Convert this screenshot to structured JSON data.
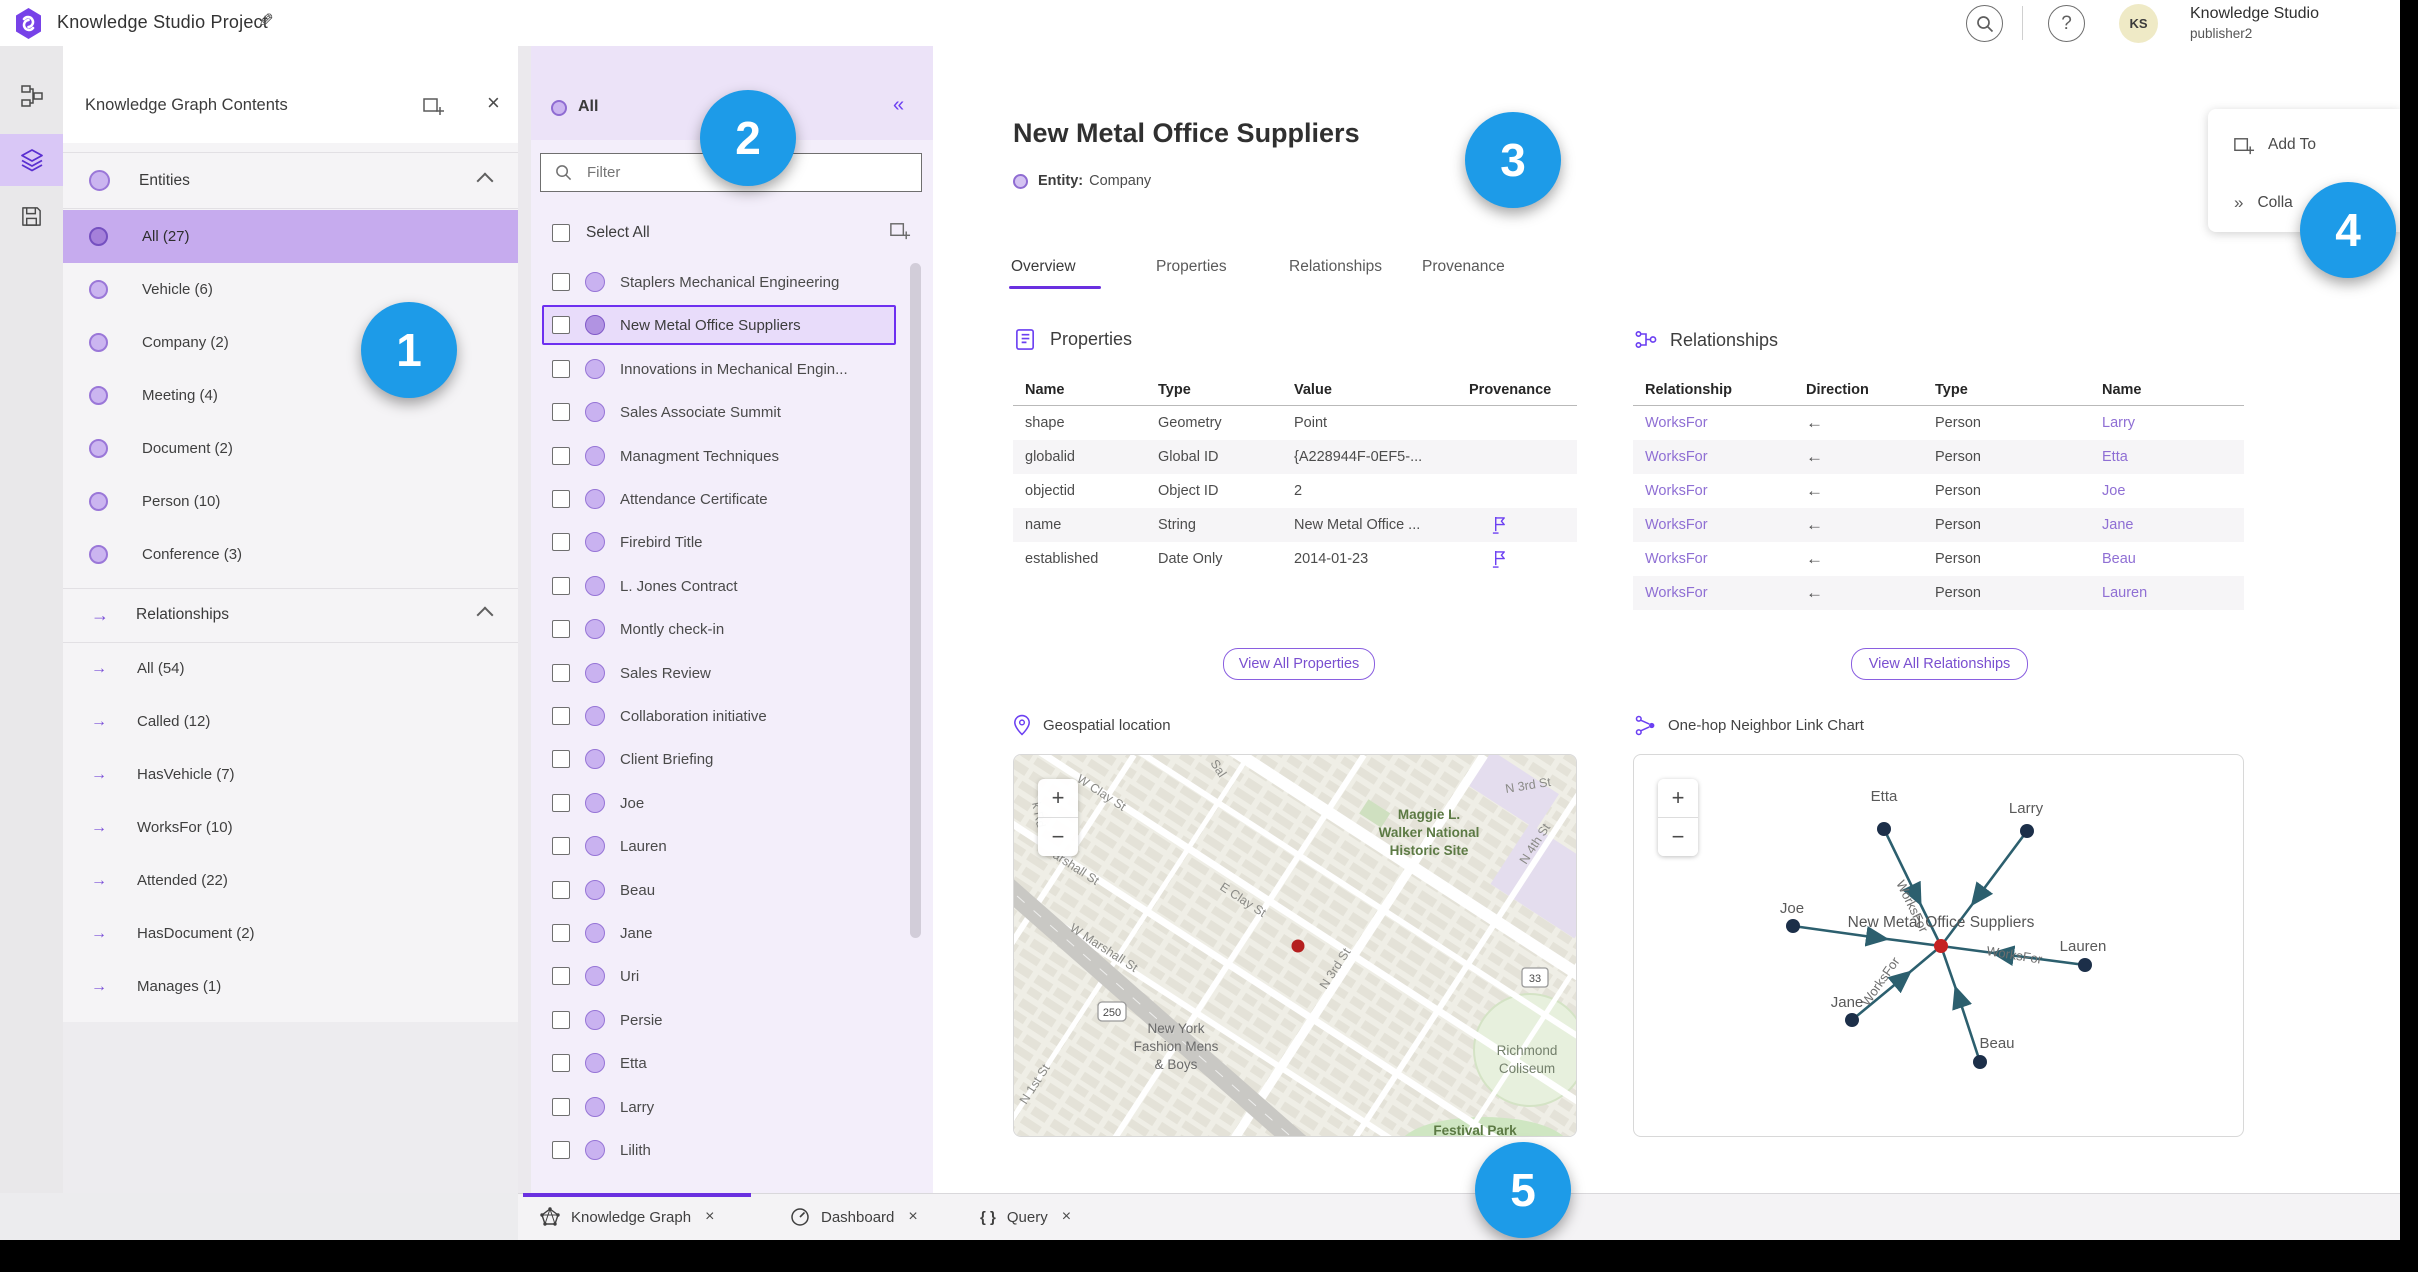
{
  "topbar": {
    "title": "Knowledge Studio Project",
    "user_initials": "KS",
    "user_name": "Knowledge Studio",
    "user_role": "publisher2"
  },
  "icons": {
    "close": "×",
    "collapse_left": "«",
    "expand_right": "»",
    "edit_pencil": "✎",
    "help": "?",
    "arrow_right": "→",
    "plus": "+",
    "minus": "−",
    "braces": "{ }"
  },
  "contents_panel": {
    "title": "Knowledge Graph Contents",
    "entities": {
      "label": "Entities",
      "items": [
        "All (27)",
        "Vehicle (6)",
        "Company (2)",
        "Meeting (4)",
        "Document (2)",
        "Person (10)",
        "Conference (3)"
      ]
    },
    "relationships": {
      "label": "Relationships",
      "items": [
        "All (54)",
        "Called (12)",
        "HasVehicle (7)",
        "WorksFor (10)",
        "Attended (22)",
        "HasDocument (2)",
        "Manages (1)"
      ]
    }
  },
  "list_panel": {
    "header": "All",
    "filter_placeholder": "Filter",
    "select_all": "Select All",
    "items": [
      "Staplers Mechanical Engineering",
      "New Metal Office Suppliers",
      "Innovations in Mechanical Engin...",
      "Sales Associate Summit",
      "Managment Techniques",
      "Attendance Certificate",
      "Firebird Title",
      "L. Jones Contract",
      "Montly check-in",
      "Sales Review",
      "Collaboration initiative",
      "Client Briefing",
      "Joe",
      "Lauren",
      "Beau",
      "Jane",
      "Uri",
      "Persie",
      "Etta",
      "Larry",
      "Lilith"
    ]
  },
  "detail": {
    "title": "New Metal Office Suppliers",
    "entity_label": "Entity:",
    "entity_type": "Company",
    "tabs": [
      "Overview",
      "Properties",
      "Relationships",
      "Provenance"
    ],
    "properties": {
      "heading": "Properties",
      "columns": [
        "Name",
        "Type",
        "Value",
        "Provenance"
      ],
      "rows": [
        {
          "name": "shape",
          "type": "Geometry",
          "value": "Point"
        },
        {
          "name": "globalid",
          "type": "Global ID",
          "value": "{A228944F-0EF5-..."
        },
        {
          "name": "objectid",
          "type": "Object ID",
          "value": "2"
        },
        {
          "name": "name",
          "type": "String",
          "value": "New Metal Office ..."
        },
        {
          "name": "established",
          "type": "Date Only",
          "value": "2014-01-23"
        }
      ],
      "view_all": "View All Properties"
    },
    "relationships": {
      "heading": "Relationships",
      "columns": [
        "Relationship",
        "Direction",
        "Type",
        "Name"
      ],
      "rows": [
        {
          "relationship": "WorksFor",
          "direction": "←",
          "type": "Person",
          "name": "Larry"
        },
        {
          "relationship": "WorksFor",
          "direction": "←",
          "type": "Person",
          "name": "Etta"
        },
        {
          "relationship": "WorksFor",
          "direction": "←",
          "type": "Person",
          "name": "Joe"
        },
        {
          "relationship": "WorksFor",
          "direction": "←",
          "type": "Person",
          "name": "Jane"
        },
        {
          "relationship": "WorksFor",
          "direction": "←",
          "type": "Person",
          "name": "Beau"
        },
        {
          "relationship": "WorksFor",
          "direction": "←",
          "type": "Person",
          "name": "Lauren"
        }
      ],
      "view_all": "View All Relationships"
    },
    "geospatial": {
      "heading": "Geospatial location",
      "streets": [
        "k Rd",
        "W Clay St",
        "Sal",
        "E Clay St",
        "arshall St",
        "W Marshall St",
        "N 3rd St",
        "N 4th St",
        "N 3rd St",
        "N 1st St"
      ],
      "places": {
        "maggie": [
          "Maggie L.",
          "Walker National",
          "Historic Site"
        ],
        "newyork": [
          "New York",
          "Fashion Mens",
          "& Boys"
        ],
        "coliseum": [
          "Richmond",
          "Coliseum"
        ],
        "festival": [
          "Festival Park"
        ]
      },
      "shields": [
        "250",
        "33"
      ]
    },
    "link_chart": {
      "heading": "One-hop Neighbor Link Chart",
      "center_label": "New Metal Office Suppliers",
      "edge_label": "WorksFor",
      "nodes": [
        "Etta",
        "Larry",
        "Joe",
        "Lauren",
        "Jane",
        "Beau"
      ]
    }
  },
  "flyout": {
    "add_to": "Add To",
    "collapse": "Colla"
  },
  "tabs_bar": {
    "items": [
      "Knowledge Graph",
      "Dashboard",
      "Query"
    ]
  },
  "annotations": [
    "1",
    "2",
    "3",
    "4",
    "5"
  ]
}
